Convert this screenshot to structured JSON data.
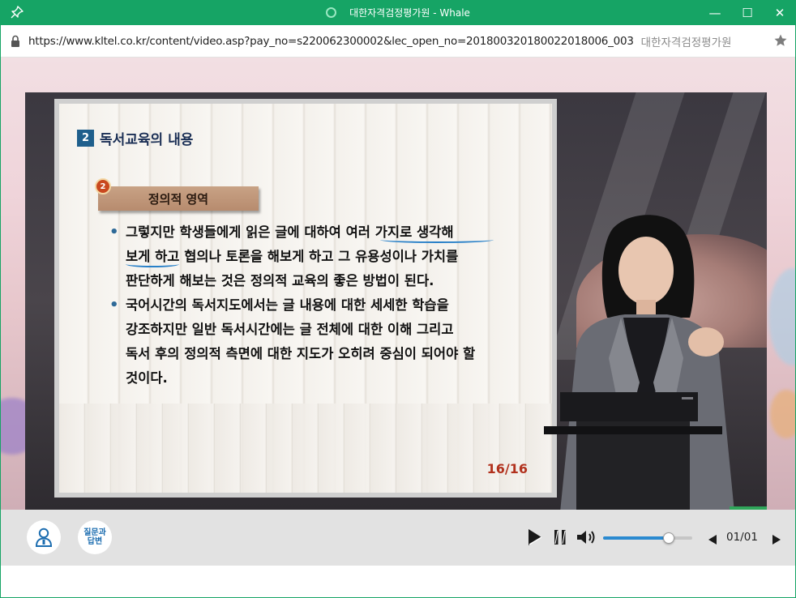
{
  "window": {
    "title": "대한자격검정평가원 - Whale",
    "buttons": {
      "minimize": "—",
      "maximize": "☐",
      "close": "✕"
    }
  },
  "address_bar": {
    "url": "https://www.kltel.co.kr/content/video.asp?pay_no=s220062300002&lec_open_no=20180032018002201800­6_003",
    "site_name": "대한자격검정평가원"
  },
  "slide": {
    "section_number": "2",
    "heading": "독서교육의 내용",
    "subsection_number": "2",
    "subsection_title": "정의적 영역",
    "bullets": [
      [
        "그렇지만 학생들에게 읽은 글에 대하여 여러 가지로 생각해",
        "보게 하고 협의나 토론을 해보게 하고 그 유용성이나 가치를",
        "판단하게 해보는 것은 정의적 교육의 좋은 방법이 된다."
      ],
      [
        "국어시간의 독서지도에서는 글 내용에 대한 세세한 학습을",
        "강조하지만 일반 독서시간에는 글 전체에 대한 이해 그리고",
        "독서 후의 정의적 측면에 대한 지도가 오히려 중심이 되어야 할",
        "것이다."
      ]
    ],
    "page_indicator": "16/16"
  },
  "player": {
    "qa_button_line1": "질문과",
    "qa_button_line2": "답변",
    "volume_level": 0.74,
    "page_counter": "01/01",
    "accent_color": "#2b8ad0"
  },
  "icons": {
    "pin": "pin-icon",
    "lock": "lock-icon",
    "star": "star-icon",
    "profile": "person-icon",
    "play": "play-icon",
    "pause": "pause-icon",
    "volume": "volume-icon",
    "prev": "prev-page-icon",
    "next": "next-page-icon"
  }
}
